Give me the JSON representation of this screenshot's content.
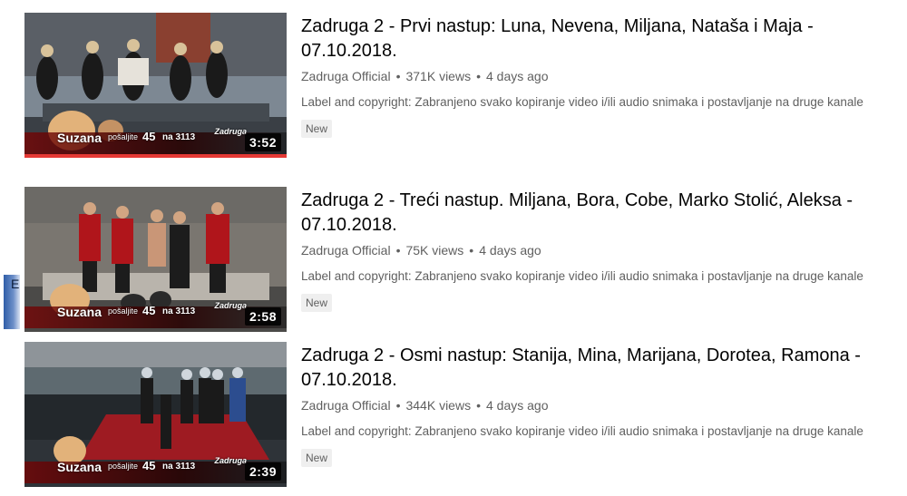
{
  "edge_label": "E",
  "videos": [
    {
      "title": "Zadruga 2 - Prvi nastup: Luna, Nevena, Miljana, Nataša i Maja - 07.10.2018.",
      "channel": "Zadruga Official",
      "views": "371K views",
      "age": "4 days ago",
      "description": "Label and copyright: Zabranjeno svako kopiranje video i/ili audio snimaka i postavljanje na druge kanale",
      "badge": "New",
      "duration": "3:52",
      "watch_progress": 1.0,
      "overlay": {
        "name": "Suzana",
        "send": "pošaljite",
        "num": "45",
        "short": "na 3113",
        "brand": "Zadruga"
      }
    },
    {
      "title": "Zadruga 2 - Treći nastup. Miljana, Bora, Cobe, Marko Stolić, Aleksa - 07.10.2018.",
      "channel": "Zadruga Official",
      "views": "75K views",
      "age": "4 days ago",
      "description": "Label and copyright: Zabranjeno svako kopiranje video i/ili audio snimaka i postavljanje na druge kanale",
      "badge": "New",
      "duration": "2:58",
      "watch_progress": 0,
      "overlay": {
        "name": "Suzana",
        "send": "pošaljite",
        "num": "45",
        "short": "na 3113",
        "brand": "Zadruga"
      }
    },
    {
      "title": "Zadruga 2 - Osmi nastup: Stanija, Mina, Marijana, Dorotea, Ramona - 07.10.2018.",
      "channel": "Zadruga Official",
      "views": "344K views",
      "age": "4 days ago",
      "description": "Label and copyright: Zabranjeno svako kopiranje video i/ili audio snimaka i postavljanje na druge kanale",
      "badge": "New",
      "duration": "2:39",
      "watch_progress": 0,
      "overlay": {
        "name": "Suzana",
        "send": "pošaljite",
        "num": "45",
        "short": "na 3113",
        "brand": "Zadruga"
      }
    }
  ],
  "colors": {
    "progress": "#e53935",
    "meta_text": "#606060",
    "title_text": "#030303"
  }
}
